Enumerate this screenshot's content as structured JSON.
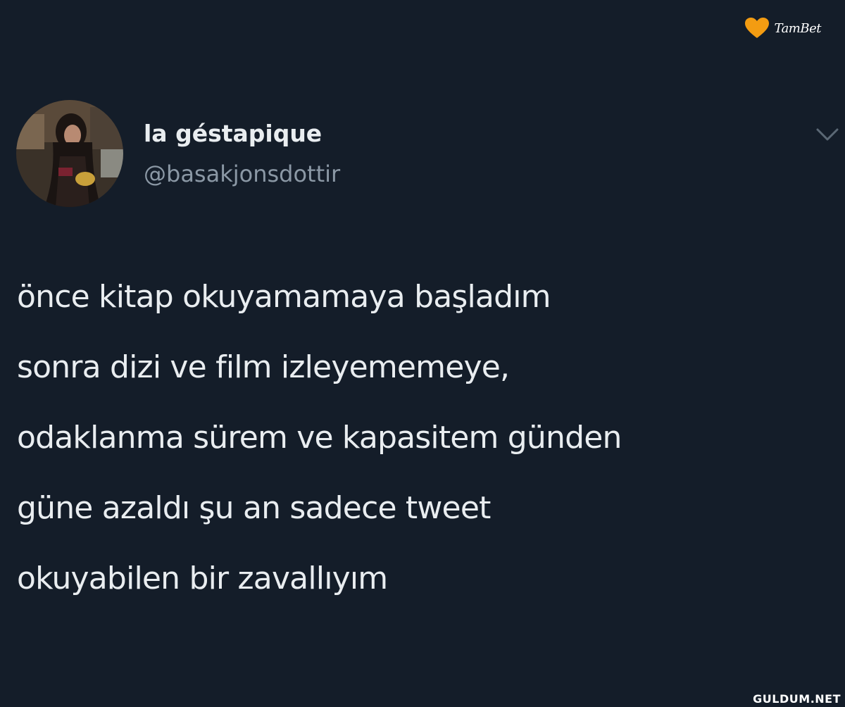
{
  "watermark": {
    "brand": "TamBet",
    "brand_color": "#f39c12",
    "icon": "heart-icon",
    "site": "GULDUM.NET"
  },
  "tweet": {
    "author": {
      "display_name": "la géstapique",
      "handle": "@basakjonsdottir"
    },
    "menu_icon": "chevron-down-icon",
    "text_lines": [
      "önce kitap okuyamamaya başladım",
      "sonra dizi ve film izleyememeye,",
      "odaklanma sürem ve kapasitem günden",
      "güne azaldı şu an sadece tweet",
      "okuyabilen bir zavallıyım"
    ]
  },
  "colors": {
    "background": "#141d29",
    "text": "#e9edf0",
    "secondary_text": "#8b98a5"
  }
}
